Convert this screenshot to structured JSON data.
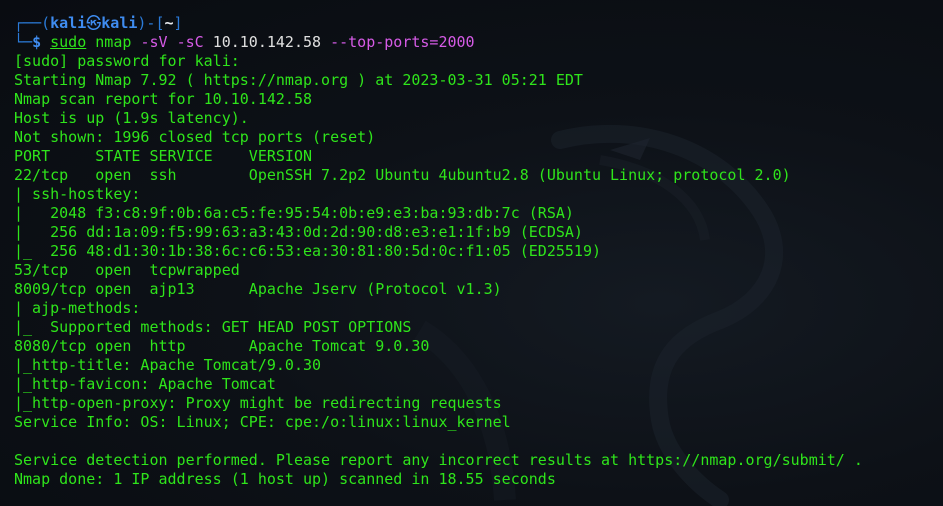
{
  "prompt": {
    "top_left": "┌──(",
    "user": "kali",
    "at_symbol": "㉿",
    "host": "kali",
    "mid": ")-[",
    "cwd": "~",
    "end": "]",
    "bottom_left": "└─",
    "dollar": "$"
  },
  "command": {
    "sudo": "sudo",
    "binary": "nmap",
    "flag1": "-sV",
    "flag2": "-sC",
    "target": "10.10.142.58",
    "flag3": "--top-ports=2000"
  },
  "output": [
    "[sudo] password for kali:",
    "Starting Nmap 7.92 ( https://nmap.org ) at 2023-03-31 05:21 EDT",
    "Nmap scan report for 10.10.142.58",
    "Host is up (1.9s latency).",
    "Not shown: 1996 closed tcp ports (reset)",
    "PORT     STATE SERVICE    VERSION",
    "22/tcp   open  ssh        OpenSSH 7.2p2 Ubuntu 4ubuntu2.8 (Ubuntu Linux; protocol 2.0)",
    "| ssh-hostkey:",
    "|   2048 f3:c8:9f:0b:6a:c5:fe:95:54:0b:e9:e3:ba:93:db:7c (RSA)",
    "|   256 dd:1a:09:f5:99:63:a3:43:0d:2d:90:d8:e3:e1:1f:b9 (ECDSA)",
    "|_  256 48:d1:30:1b:38:6c:c6:53:ea:30:81:80:5d:0c:f1:05 (ED25519)",
    "53/tcp   open  tcpwrapped",
    "8009/tcp open  ajp13      Apache Jserv (Protocol v1.3)",
    "| ajp-methods:",
    "|_  Supported methods: GET HEAD POST OPTIONS",
    "8080/tcp open  http       Apache Tomcat 9.0.30",
    "|_http-title: Apache Tomcat/9.0.30",
    "|_http-favicon: Apache Tomcat",
    "|_http-open-proxy: Proxy might be redirecting requests",
    "Service Info: OS: Linux; CPE: cpe:/o:linux:linux_kernel",
    "",
    "Service detection performed. Please report any incorrect results at https://nmap.org/submit/ .",
    "Nmap done: 1 IP address (1 host up) scanned in 18.55 seconds"
  ],
  "colors": {
    "background": "#0d1117",
    "output_text": "#2fe51b",
    "prompt_frame": "#2b7bd9",
    "prompt_user": "#3f8cf0",
    "cwd": "#e8eaee",
    "command_args": "#d65be6"
  }
}
